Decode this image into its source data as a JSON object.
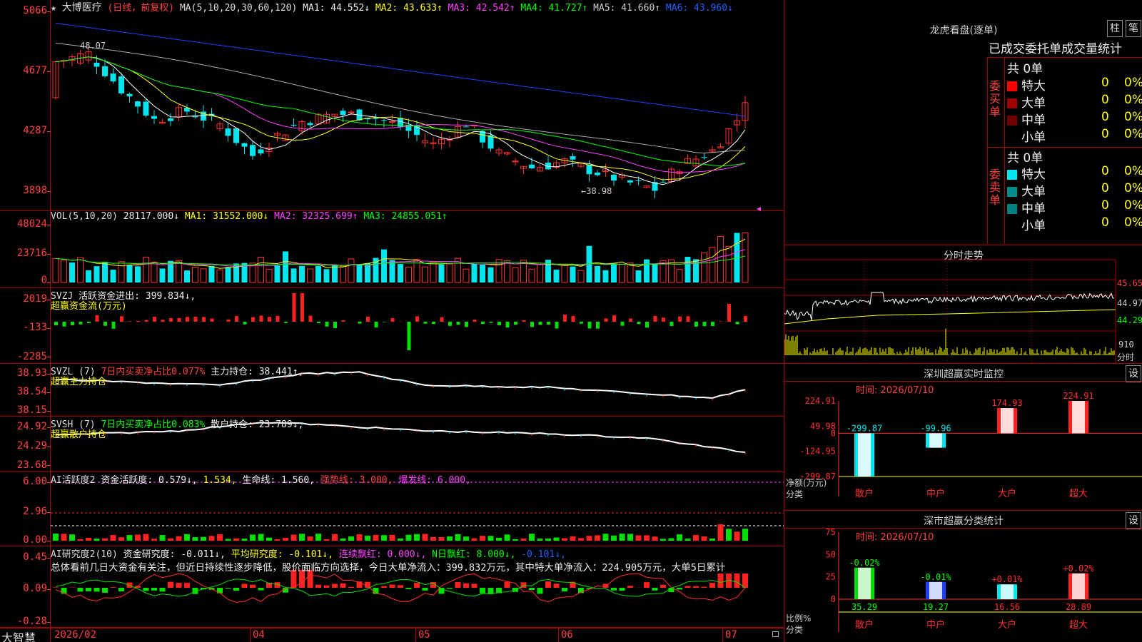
{
  "k": {
    "star": "★",
    "stock_name": "大博医疗",
    "mode": "(日线，前复权)",
    "ma_params": "MA(5,10,20,30,60,120)",
    "ma1": "MA1: 44.552↓",
    "ma2": "MA2: 43.633↑",
    "ma3": "MA3: 42.542↑",
    "ma4": "MA4: 41.727↑",
    "ma5": "MA5: 41.660↑",
    "ma6": "MA6: 43.960↓",
    "y_labels": [
      "5066",
      "4677",
      "4287",
      "3898"
    ],
    "high_label": "48.07",
    "low_label": "←38.98"
  },
  "vol": {
    "params": "VOL(5,10,20)",
    "value": "28117.000↓",
    "ma1": "MA1: 31552.000↓",
    "ma2": "MA2: 32325.699↑",
    "ma3": "MA3: 24855.051↑",
    "y_labels": [
      "48024",
      "23716",
      "0"
    ]
  },
  "svzj": {
    "name": "SVZJ",
    "label": "活跃资金进出: 399.834↓,",
    "sub": "超赢资金流(万元)",
    "y_labels": [
      "2019",
      "-133",
      "-2285"
    ]
  },
  "svzl": {
    "name": "SVZL (7)",
    "ratio": "7日内买卖净占比0.077%",
    "hold": "主力持仓: 38.441↑,",
    "sub": "超赢主力持仓",
    "y_labels": [
      "38.93",
      "38.54",
      "38.15"
    ]
  },
  "svsh": {
    "name": "SVSH (7)",
    "ratio": "7日内买卖净占比0.083%",
    "hold": "散户持仓: 23.789↓,",
    "sub": "超赢散户持仓",
    "y_labels": [
      "24.92",
      "24.29",
      "23.68"
    ]
  },
  "ai": {
    "name": "AI活跃度2",
    "a": "资金活跃度: 0.579↓,",
    "b": "1.534,",
    "c": "生命线: 1.560,",
    "d": "强势线: 3.000,",
    "e": "爆发线: 6.000,",
    "y_labels": [
      "6.00",
      "2.96",
      "0.00"
    ]
  },
  "res": {
    "name": "AI研究度2(10)",
    "a": "资金研究度: -0.011↓,",
    "b": "平均研究度: -0.101↓,",
    "c": "连续飘红: 0.000↓,",
    "d": "N日飘红: 8.000↓,",
    "e": "-0.101↓,",
    "summary": "总体看前几日大资金有关注，但近日持续性逐步降低，股价面临方向选择，今日大单净流入：399.832万元，其中特大单净流入：224.905万元，大单5日累计",
    "y_labels": [
      "0.45",
      "0.09",
      "-0.28"
    ]
  },
  "xaxis": {
    "brand": "大智慧",
    "labels": [
      "2026/02",
      "04",
      "05",
      "06",
      "07"
    ]
  },
  "dragon": {
    "title": "龙虎看盘(逐单)",
    "btn_zhu": "柱",
    "btn_bi": "笔",
    "tabs": "已成交委托单成交量统计",
    "buy_side": "委买单",
    "sell_side": "委卖单",
    "buy_total": "共 0单",
    "sell_total": "共 0单",
    "buy_rows": [
      {
        "name": "特大",
        "count": "0",
        "pct": "0%",
        "color": "#ff0000"
      },
      {
        "name": "大单",
        "count": "0",
        "pct": "0%",
        "color": "#a00000"
      },
      {
        "name": "中单",
        "count": "0",
        "pct": "0%",
        "color": "#700000"
      },
      {
        "name": "小单",
        "count": "0",
        "pct": "0%",
        "color": ""
      }
    ],
    "sell_rows": [
      {
        "name": "特大",
        "count": "0",
        "pct": "0%",
        "color": "#00e5ee"
      },
      {
        "name": "大单",
        "count": "0",
        "pct": "0%",
        "color": "#008b8b"
      },
      {
        "name": "中单",
        "count": "0",
        "pct": "0%",
        "color": "#008080"
      },
      {
        "name": "小单",
        "count": "0",
        "pct": "0%",
        "color": ""
      }
    ]
  },
  "intraday": {
    "title": "分时走势",
    "price_labels": [
      "45.65",
      "44.97",
      "44.29"
    ],
    "vol_label": "910",
    "vol_unit": "分时"
  },
  "monitor": {
    "title": "深圳超赢实时监控",
    "btn": "设",
    "time": "时间: 2026/07/10",
    "y_labels": [
      "224.91",
      "49.98",
      "0",
      "-124.95",
      "-299.87"
    ],
    "y_title_a": "净额(万元)",
    "y_title_b": "分类",
    "categories": [
      "散户",
      "中户",
      "大户",
      "超大"
    ],
    "values": [
      -299.87,
      -99.96,
      174.93,
      224.91
    ],
    "value_labels": [
      "-299.87",
      "-99.96",
      "174.93",
      "224.91"
    ]
  },
  "stats": {
    "title": "深市超赢分类统计",
    "btn": "设",
    "time": "时间: 2026/07/10",
    "y_labels": [
      "75",
      "50",
      "25",
      "0"
    ],
    "y_title_a": "比例%",
    "y_title_b": "分类",
    "categories": [
      "散户",
      "中户",
      "大户",
      "超大"
    ],
    "values": [
      35.29,
      19.27,
      16.56,
      28.89
    ],
    "value_labels": [
      "35.29",
      "19.27",
      "16.56",
      "28.89"
    ],
    "change_labels": [
      "-0.02%",
      "-0.01%",
      "+0.01%",
      "+0.02%"
    ]
  }
}
